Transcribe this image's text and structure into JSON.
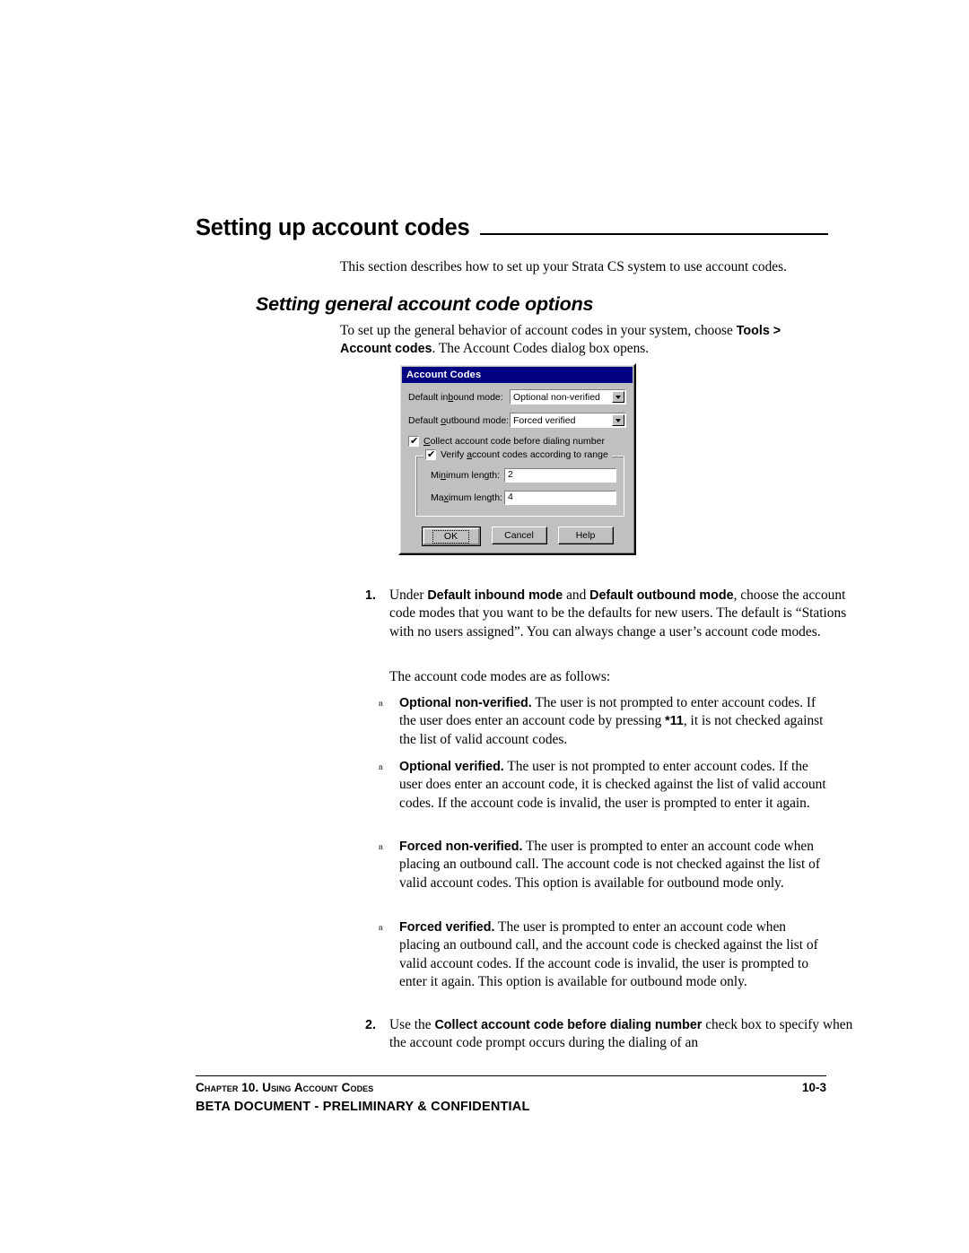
{
  "section": {
    "title": "Setting up account codes",
    "intro": "This section describes how to set up your Strata CS system to use account codes.",
    "subheading": "Setting general account code options",
    "instruction_pre": "To set up the general behavior of account codes in your system, choose ",
    "instruction_bold1": "Tools > Account codes",
    "instruction_post": ". The Account Codes dialog box opens."
  },
  "dialog": {
    "title": "Account Codes",
    "inbound": {
      "label_pre": "Default in",
      "label_acc": "b",
      "label_post": "ound mode:",
      "value": "Optional non-verified"
    },
    "outbound": {
      "label_pre": "Default ",
      "label_acc": "o",
      "label_post": "utbound mode:",
      "value": "Forced verified"
    },
    "collect_checkbox": {
      "checked": true,
      "mark": "✔",
      "label_acc": "C",
      "label_post": "ollect account code before dialing number"
    },
    "group": {
      "checkbox_checked": true,
      "mark": "✔",
      "legend_pre": "Verify ",
      "legend_acc": "a",
      "legend_post": "ccount codes according to range",
      "min": {
        "label_pre": "Mi",
        "label_acc": "n",
        "label_post": "imum length:",
        "value": "2"
      },
      "max": {
        "label_pre": "Ma",
        "label_acc": "x",
        "label_post": "imum length:",
        "value": "4"
      }
    },
    "buttons": {
      "ok": "OK",
      "cancel": "Cancel",
      "help": "Help"
    },
    "colors": {
      "titlebar": "#000080",
      "face": "#c0c0c0",
      "field": "#ffffff"
    }
  },
  "steps": [
    {
      "number": "1.",
      "segments": [
        {
          "t": "Under ",
          "b": false
        },
        {
          "t": "Default inbound mode",
          "b": true
        },
        {
          "t": " and ",
          "b": false
        },
        {
          "t": "Default outbound mode",
          "b": true
        },
        {
          "t": ", choose the account code modes that you want to be the defaults for new users. The default is “Stations with no users assigned”. You can always change a user’s account code modes.",
          "b": false
        }
      ]
    },
    {
      "number": "2.",
      "segments": [
        {
          "t": "Use the ",
          "b": false
        },
        {
          "t": "Collect account code before dialing number",
          "b": true
        },
        {
          "t": " check box to specify when the account code prompt occurs during the dialing of an",
          "b": false
        }
      ]
    }
  ],
  "modes_lead": "The account code modes are as follows:",
  "bullet_marker": "n",
  "bullets": [
    {
      "segments": [
        {
          "t": "Optional non-verified.",
          "b": true
        },
        {
          "t": " The user is not prompted to enter account codes. If the user does enter an account code by pressing ",
          "b": false
        },
        {
          "t": "*11",
          "b": true
        },
        {
          "t": ", it is not checked against the list of valid account codes.",
          "b": false
        }
      ]
    },
    {
      "segments": [
        {
          "t": "Optional verified.",
          "b": true
        },
        {
          "t": " The user is not prompted to enter account codes. If the user does enter an account code, it is checked against the list of valid account codes. If the account code is invalid, the user is prompted to enter it again.",
          "b": false
        }
      ]
    },
    {
      "segments": [
        {
          "t": "Forced non-verified.",
          "b": true
        },
        {
          "t": " The user is prompted to enter an account code when placing an outbound call. The account code is not checked against the list of valid account codes. This option is available for outbound mode only.",
          "b": false
        }
      ]
    },
    {
      "segments": [
        {
          "t": "Forced verified.",
          "b": true
        },
        {
          "t": " The user is prompted to enter an account code when placing an outbound call, and the account code is checked against the list of valid account codes. If the account code is invalid, the user is prompted to enter it again. This option is available for outbound mode only.",
          "b": false
        }
      ]
    }
  ],
  "footer": {
    "chapter": "Chapter 10. Using Account Codes",
    "page": "10-3",
    "notice": "BETA DOCUMENT - PRELIMINARY & CONFIDENTIAL"
  }
}
